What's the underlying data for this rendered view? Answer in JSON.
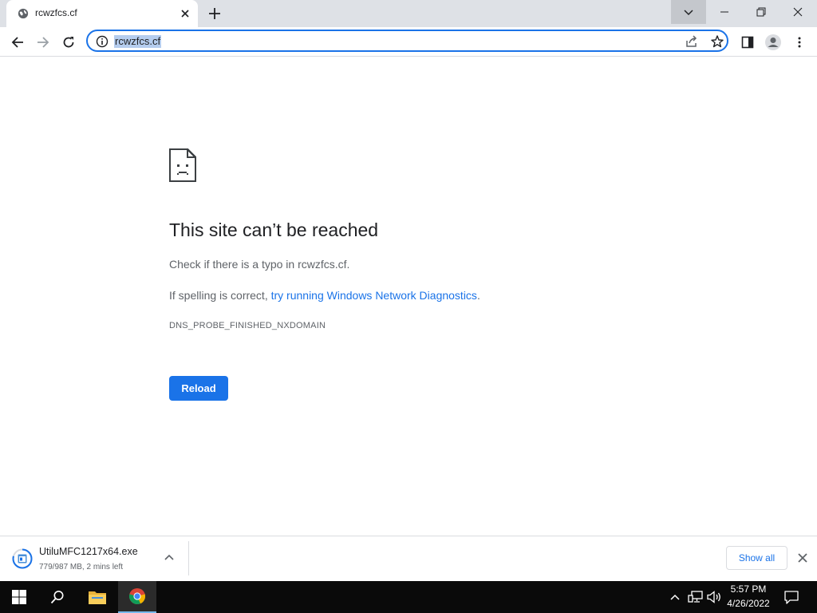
{
  "browser": {
    "tab_title": "rcwzfcs.cf",
    "url": "rcwzfcs.cf"
  },
  "error_page": {
    "title": "This site can’t be reached",
    "hint_typo": "Check if there is a typo in rcwzfcs.cf.",
    "hint_spelling_prefix": "If spelling is correct, ",
    "hint_spelling_link": "try running Windows Network Diagnostics",
    "hint_spelling_suffix": ".",
    "error_code": "DNS_PROBE_FINISHED_NXDOMAIN",
    "reload_label": "Reload"
  },
  "download_shelf": {
    "file_name": "UtiluMFC1217x64.exe",
    "status": "779/987 MB, 2 mins left",
    "progress": 0.79,
    "show_all_label": "Show all"
  },
  "taskbar": {
    "time": "5:57 PM",
    "date": "4/26/2022"
  },
  "colors": {
    "accent": "#1a73e8",
    "tabstrip": "#dee1e6",
    "taskbar": "#0a0a0a"
  }
}
